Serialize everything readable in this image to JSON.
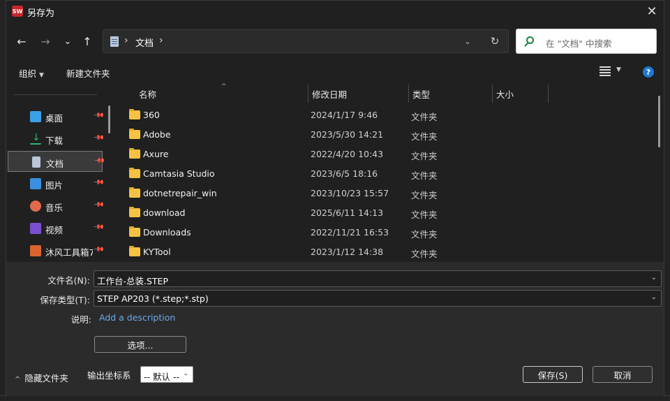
{
  "window": {
    "title": "另存为",
    "app_icon_text": "SW"
  },
  "nav": {
    "back_icon": "←",
    "forward_icon": "→",
    "recent_icon": "⌄",
    "up_icon": "↑",
    "address_path": "文档",
    "search_placeholder": "在 \"文档\" 中搜索"
  },
  "toolbar": {
    "organize_label": "组织",
    "new_folder_label": "新建文件夹"
  },
  "sidebar": {
    "items": [
      {
        "label": "桌面",
        "icon": "desktop-icon",
        "color": "#3aa0e8"
      },
      {
        "label": "下载",
        "icon": "download-icon",
        "color": "#2fb36c"
      },
      {
        "label": "文档",
        "icon": "documents-icon",
        "color": "#b8c7d9",
        "selected": true
      },
      {
        "label": "图片",
        "icon": "pictures-icon",
        "color": "#3b8fe0"
      },
      {
        "label": "音乐",
        "icon": "music-icon",
        "color": "#e06a4a"
      },
      {
        "label": "视频",
        "icon": "videos-icon",
        "color": "#7a4fd1"
      },
      {
        "label": "沐风工具箱7",
        "icon": "app-folder-icon",
        "color": "#d9632c"
      }
    ]
  },
  "columns": {
    "name": "名称",
    "modified": "修改日期",
    "type": "类型",
    "size": "大小"
  },
  "files": [
    {
      "name": "360",
      "modified": "2024/1/17 9:46",
      "type": "文件夹"
    },
    {
      "name": "Adobe",
      "modified": "2023/5/30 14:21",
      "type": "文件夹"
    },
    {
      "name": "Axure",
      "modified": "2022/4/20 10:43",
      "type": "文件夹"
    },
    {
      "name": "Camtasia Studio",
      "modified": "2023/6/5 18:16",
      "type": "文件夹"
    },
    {
      "name": "dotnetrepair_win",
      "modified": "2023/10/23 15:57",
      "type": "文件夹"
    },
    {
      "name": "download",
      "modified": "2025/6/11 14:13",
      "type": "文件夹"
    },
    {
      "name": "Downloads",
      "modified": "2022/11/21 16:53",
      "type": "文件夹"
    },
    {
      "name": "KYTool",
      "modified": "2023/1/12 14:38",
      "type": "文件夹"
    }
  ],
  "form": {
    "filename_label": "文件名(N):",
    "filename_value": "工作台-总装.STEP",
    "filetype_label": "保存类型(T):",
    "filetype_value": "STEP AP203 (*.step;*.stp)",
    "description_label": "说明:",
    "description_link": "Add a description",
    "options_button": "选项...",
    "hide_folders_label": "隐藏文件夹",
    "coord_label": "输出坐标系",
    "coord_value": "-- 默认 --",
    "save_button": "保存(S)",
    "cancel_button": "取消"
  },
  "colors": {
    "accent": "#1f78d1",
    "link": "#6aa9f0",
    "folder": "#f6c244"
  }
}
